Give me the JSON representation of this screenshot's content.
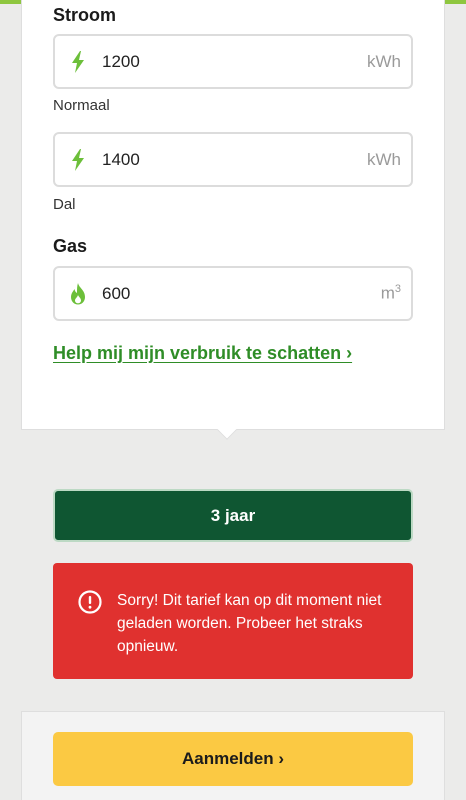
{
  "energy": {
    "stroom_label": "Stroom",
    "stroom_normaal": {
      "value": "1200",
      "unit": "kWh"
    },
    "normaal_label": "Normaal",
    "stroom_dal": {
      "value": "1400",
      "unit": "kWh"
    },
    "dal_label": "Dal",
    "gas_label": "Gas",
    "gas": {
      "value": "600",
      "unit": "m",
      "unit_sup": "3"
    },
    "help_link": "Help mij mijn verbruik te schatten ›"
  },
  "contract": {
    "term_button": "3 jaar"
  },
  "error": {
    "message": "Sorry! Dit tarief kan op dit moment niet geladen worden. Probeer het straks opnieuw."
  },
  "footer": {
    "signup_button": "Aanmelden ›"
  },
  "colors": {
    "accent_green": "#8ec63f",
    "link_green": "#2f8d27",
    "dark_green": "#0f5632",
    "error_red": "#e0312f",
    "cta_yellow": "#fbc943"
  },
  "icons": [
    "lightning-icon",
    "lightning-icon",
    "flame-icon",
    "alert-circle-icon"
  ]
}
